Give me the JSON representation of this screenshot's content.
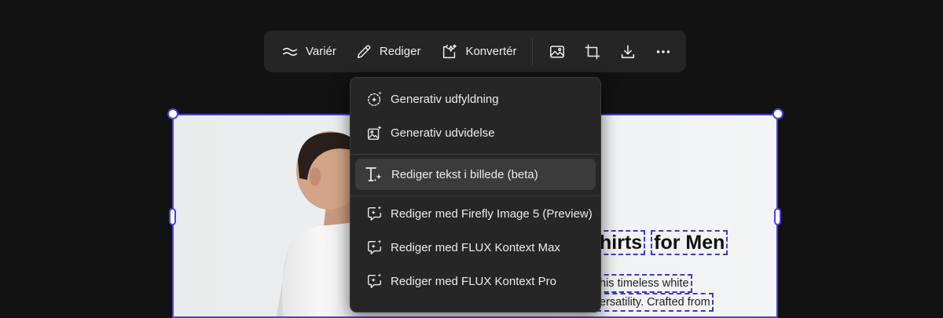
{
  "toolbar": {
    "vary_label": "Variér",
    "edit_label": "Rediger",
    "convert_label": "Konvertér"
  },
  "menu": {
    "items": [
      {
        "label": "Generativ udfyldning"
      },
      {
        "label": "Generativ udvidelse"
      },
      {
        "label": "Rediger tekst i billede (beta)"
      },
      {
        "label": "Rediger med Firefly Image 5 (Preview)"
      },
      {
        "label": "Rediger med FLUX Kontext Max"
      },
      {
        "label": "Rediger med FLUX Kontext Pro"
      }
    ]
  },
  "image_text": {
    "heading_part1": "hirts",
    "heading_part2": "for Men",
    "para_line1": "his timeless white",
    "para_line2": "ersatility. Crafted from"
  },
  "colors": {
    "selection": "#4b45d6",
    "background": "#121212",
    "toolbar": "#252525",
    "menu": "#262626",
    "menu_active": "#3b3b3b"
  }
}
